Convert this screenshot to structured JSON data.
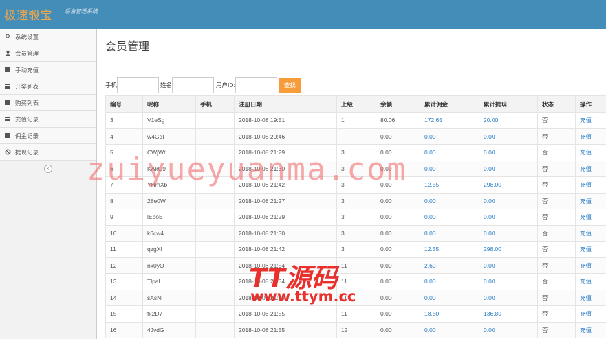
{
  "header": {
    "brand": "极速骰宝",
    "subtitle": "后台管理系统"
  },
  "sidebar": {
    "items": [
      {
        "label": "系统设置",
        "icon": "gear-icon"
      },
      {
        "label": "会员管理",
        "icon": "user-icon"
      },
      {
        "label": "手动充值",
        "icon": "list-icon"
      },
      {
        "label": "开奖列表",
        "icon": "list-icon"
      },
      {
        "label": "购买列表",
        "icon": "list-icon"
      },
      {
        "label": "充值记录",
        "icon": "list-icon"
      },
      {
        "label": "佣金记录",
        "icon": "list-icon"
      },
      {
        "label": "提现记录",
        "icon": "ban-icon"
      }
    ],
    "collapse_icon": "chevron-left-icon",
    "collapse_glyph": "‹"
  },
  "main": {
    "title": "会员管理",
    "search": {
      "phone_label": "手机",
      "name_label": "姓名",
      "uid_label": "用户ID",
      "button": "查找"
    },
    "table": {
      "columns": [
        "编号",
        "昵称",
        "手机",
        "注册日期",
        "上级",
        "余额",
        "累计佣金",
        "累计提现",
        "状态",
        "操作"
      ],
      "rows": [
        [
          "3",
          "V1eSg",
          "",
          "2018-10-08 19:51",
          "1",
          "80.06",
          "172.65",
          "20.00",
          "否",
          "充值"
        ],
        [
          "4",
          "w4GqF",
          "",
          "2018-10-08 20:46",
          "",
          "0.00",
          "0.00",
          "0.00",
          "否",
          "充值"
        ],
        [
          "5",
          "CWjWt",
          "",
          "2018-10-08 21:29",
          "3",
          "0.00",
          "0.00",
          "0.00",
          "否",
          "充值"
        ],
        [
          "6",
          "KAkG9",
          "",
          "2018-10-08 21:30",
          "3",
          "0.00",
          "0.00",
          "0.00",
          "否",
          "充值"
        ],
        [
          "7",
          "YHmXb",
          "",
          "2018-10-08 21:42",
          "3",
          "0.00",
          "12.55",
          "298.00",
          "否",
          "充值"
        ],
        [
          "8",
          "28e0W",
          "",
          "2018-10-08 21:27",
          "3",
          "0.00",
          "0.00",
          "0.00",
          "否",
          "充值"
        ],
        [
          "9",
          "lEboE",
          "",
          "2018-10-08 21:29",
          "3",
          "0.00",
          "0.00",
          "0.00",
          "否",
          "充值"
        ],
        [
          "10",
          "k6cw4",
          "",
          "2018-10-08 21:30",
          "3",
          "0.00",
          "0.00",
          "0.00",
          "否",
          "充值"
        ],
        [
          "11",
          "qzgXl",
          "",
          "2018-10-08 21:42",
          "3",
          "0.00",
          "12.55",
          "298.00",
          "否",
          "充值"
        ],
        [
          "12",
          "nx0yO",
          "",
          "2018-10-08 21:54",
          "11",
          "0.00",
          "2.60",
          "0.00",
          "否",
          "充值"
        ],
        [
          "13",
          "TlpaU",
          "",
          "2018-10-08 21:54",
          "11",
          "0.00",
          "0.00",
          "0.00",
          "否",
          "充值"
        ],
        [
          "14",
          "sAsNl",
          "",
          "2018-10-08 21:54",
          "11",
          "0.00",
          "0.00",
          "0.00",
          "否",
          "充值"
        ],
        [
          "15",
          "fx2D7",
          "",
          "2018-10-08 21:55",
          "11",
          "0.00",
          "18.50",
          "136.80",
          "否",
          "充值"
        ],
        [
          "16",
          "4JvdG",
          "",
          "2018-10-08 21:55",
          "12",
          "0.00",
          "0.00",
          "0.00",
          "否",
          "充值"
        ]
      ]
    }
  },
  "watermarks": {
    "line1": "zuiyueyuanma.com",
    "line2": "TT源码",
    "line3": "www.ttym.cc"
  },
  "colors": {
    "topbar": "#438eb9",
    "brand": "#f0a64b",
    "link": "#2a7cc7",
    "search_button": "#f79c3a",
    "watermark_pink": "#f07373",
    "watermark_red": "#e8302d"
  }
}
